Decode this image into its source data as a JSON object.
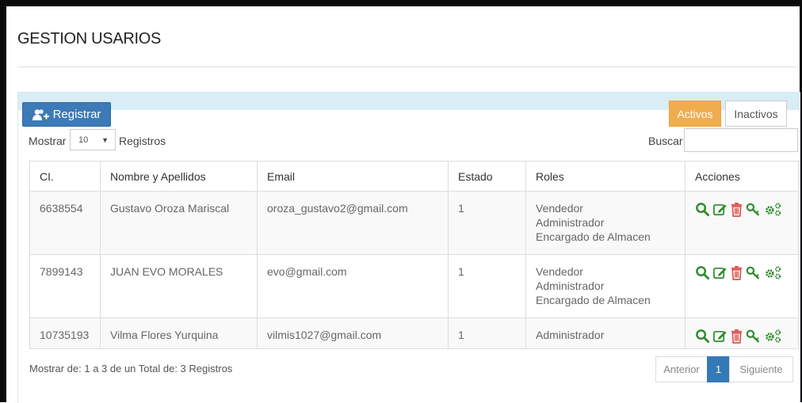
{
  "page": {
    "title": "GESTION USARIOS"
  },
  "toolbar": {
    "register_label": "Registrar",
    "activos_label": "Activos",
    "inactivos_label": "Inactivos",
    "mostrar_label": "Mostrar",
    "page_size_value": "10",
    "registros_label": "Registros",
    "buscar_label": "Buscar:",
    "buscar_value": ""
  },
  "table": {
    "headers": [
      "CI.",
      "Nombre y Apellidos",
      "Email",
      "Estado",
      "Roles",
      "Acciones"
    ],
    "rows": [
      {
        "ci": "6638554",
        "name": "Gustavo Oroza Mariscal",
        "email": "oroza_gustavo2@gmail.com",
        "estado": "1",
        "roles": [
          "Vendedor",
          "Administrador",
          "Encargado de Almacen"
        ]
      },
      {
        "ci": "7899143",
        "name": "JUAN EVO MORALES",
        "email": "evo@gmail.com",
        "estado": "1",
        "roles": [
          "Vendedor",
          "Administrador",
          "Encargado de Almacen"
        ]
      },
      {
        "ci": "10735193",
        "name": "Vilma Flores Yurquina",
        "email": "vilmis1027@gmail.com",
        "estado": "1",
        "roles": [
          "Administrador"
        ]
      }
    ]
  },
  "footer": {
    "info": "Mostrar de: 1 a 3 de un Total de: 3 Registros",
    "prev_label": "Anterior",
    "current_page": "1",
    "next_label": "Siguiente"
  },
  "icons": {
    "register": "add-user-icon",
    "actions": [
      "search-icon",
      "edit-icon",
      "trash-icon",
      "key-icon",
      "gears-icon"
    ]
  },
  "colors": {
    "primary": "#3c7ab8",
    "warning": "#f0ad4e",
    "action_green": "#2e8b2e",
    "action_red": "#d9534f",
    "panel_header": "#d9edf7"
  }
}
